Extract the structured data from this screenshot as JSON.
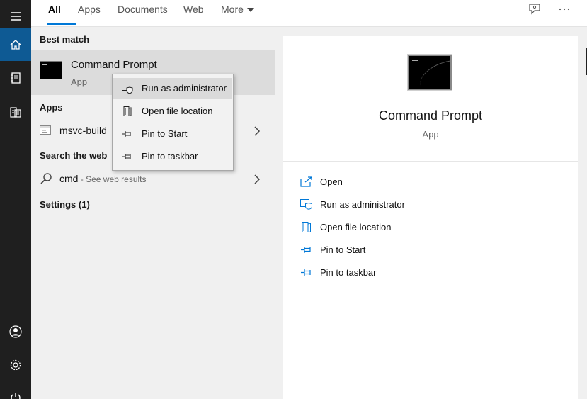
{
  "accent_color": "#0078d7",
  "tabs": [
    {
      "label": "All",
      "active": true
    },
    {
      "label": "Apps"
    },
    {
      "label": "Documents"
    },
    {
      "label": "Web"
    },
    {
      "label": "More"
    }
  ],
  "top_icons": [
    "feedback-icon",
    "more-options-icon"
  ],
  "rail": {
    "top": [
      "hamburger-menu-icon",
      "home-icon",
      "notebook-icon",
      "documents-icon"
    ],
    "bottom": [
      "user-account-icon",
      "settings-gear-icon",
      "power-icon"
    ]
  },
  "results": {
    "best_match_header": "Best match",
    "best_match": {
      "title": "Command Prompt",
      "subtitle": "App",
      "icon": "command-prompt-icon"
    },
    "apps_header": "Apps",
    "app_item": {
      "label": "msvc-build",
      "icon": "app-window-icon"
    },
    "web_header": "Search the web",
    "web_item": {
      "query": "cmd",
      "suffix": " - See web results",
      "icon": "search-icon"
    },
    "settings_header": "Settings (1)"
  },
  "context_menu": [
    {
      "label": "Run as administrator",
      "icon": "shield-admin-icon",
      "highlighted": true
    },
    {
      "label": "Open file location",
      "icon": "file-location-icon"
    },
    {
      "label": "Pin to Start",
      "icon": "pin-icon"
    },
    {
      "label": "Pin to taskbar",
      "icon": "pin-icon"
    }
  ],
  "detail": {
    "title": "Command Prompt",
    "subtitle": "App",
    "icon": "command-prompt-icon",
    "actions": [
      {
        "label": "Open",
        "icon": "open-icon"
      },
      {
        "label": "Run as administrator",
        "icon": "shield-admin-icon"
      },
      {
        "label": "Open file location",
        "icon": "file-location-icon"
      },
      {
        "label": "Pin to Start",
        "icon": "pin-icon"
      },
      {
        "label": "Pin to taskbar",
        "icon": "pin-icon"
      }
    ]
  }
}
